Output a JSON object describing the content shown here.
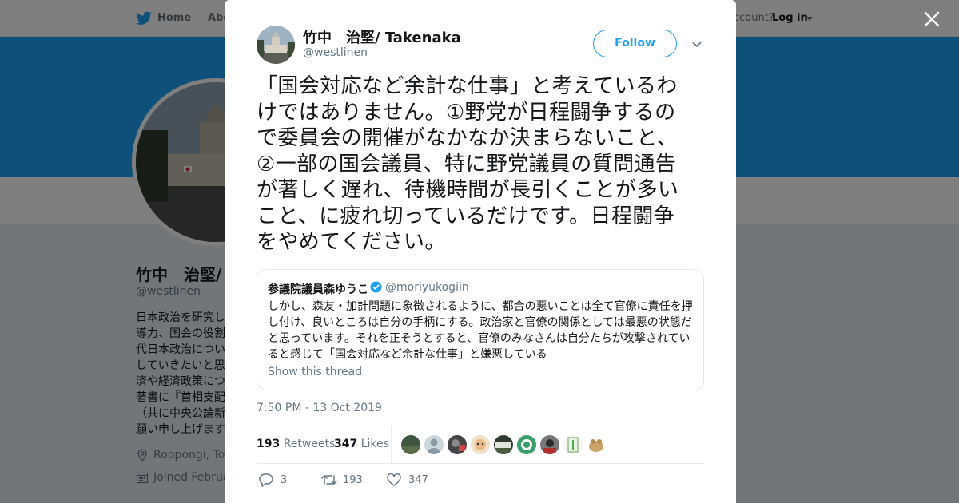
{
  "background": {
    "nav": {
      "home": "Home",
      "about": "Abo",
      "account_prompt": "ccount?",
      "login": "Log in"
    },
    "profile": {
      "name": "竹中　治堅/",
      "handle": "@westlinen",
      "bio_lines": [
        "日本政治を研究し",
        "導力、国会の役割",
        "代日本政治につい",
        "していきたいと思",
        "済や経済政策につ",
        "著書に『首相支配",
        "（共に中央公論新",
        "願い申し上げます"
      ],
      "location": "Roppongi, Tok",
      "joined": "Joined Februa"
    }
  },
  "tweet": {
    "author_name": "竹中　治堅/ Takenaka",
    "author_handle": "@westlinen",
    "follow_label": "Follow",
    "text_lines": [
      "「国会対応など余計な仕事」と考えているわ",
      "けではありません。①野党が日程闘争するの",
      "で委員会の開催がなかなか決まらないこと、",
      "②一部の国会議員、特に野党議員の質問通告",
      "が著しく遅れ、待機時間が長引くことが多い",
      "こと、に疲れ切っているだけです。日程闘争",
      "をやめてください。"
    ],
    "quote": {
      "name": "参議院議員森ゆうこ",
      "handle": "@moriyukogiin",
      "text_lines": [
        "しかし、森友・加計問題に象徴されるように、都合の悪いことは全て官僚に責任を押",
        "し付け、良いところは自分の手柄にする。政治家と官僚の関係としては最悪の状態だ",
        "と思っています。それを正そうとすると、官僚のみなさんは自分たちが攻撃されてい",
        "ると感じて「国会対応など余計な仕事」と嫌悪している"
      ],
      "thread_link": "Show this thread"
    },
    "timestamp": "7:50 PM - 13 Oct 2019",
    "retweets": {
      "count": "193",
      "label": "Retweets"
    },
    "likes": {
      "count": "347",
      "label": "Likes"
    },
    "actions": {
      "replies": "3",
      "retweets": "193",
      "likes": "347"
    }
  },
  "colors": {
    "accent": "#1da1f2",
    "muted": "#657786",
    "text": "#14171a"
  }
}
